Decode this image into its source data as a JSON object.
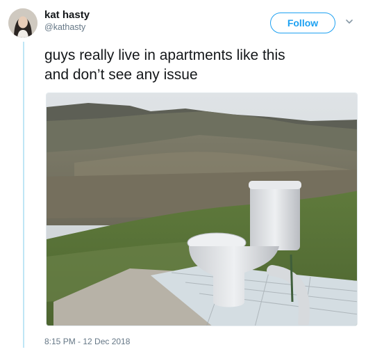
{
  "author": {
    "name": "kat hasty",
    "handle": "@kathasty"
  },
  "actions": {
    "follow_label": "Follow"
  },
  "tweet": {
    "line1": "guys really live in apartments like this",
    "line2": "and don’t see any issue",
    "timestamp": "8:15 PM - 12 Dec 2018"
  },
  "icons": {
    "menu": "chevron-down-icon"
  },
  "colors": {
    "accent": "#1da1f2",
    "secondary_text": "#657786",
    "thread_rail": "#bfe6f5"
  }
}
